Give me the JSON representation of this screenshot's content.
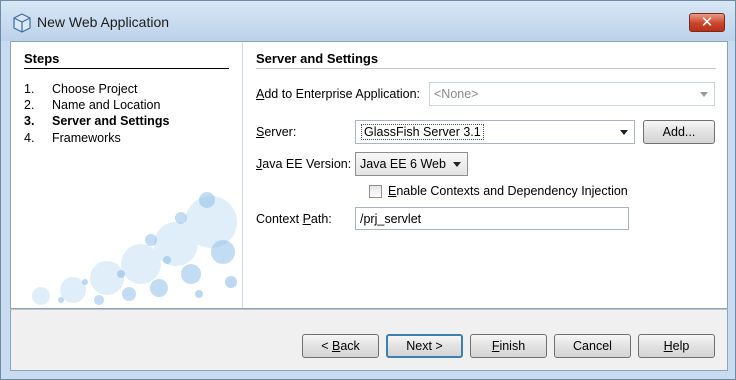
{
  "window": {
    "title": "New Web Application"
  },
  "steps": {
    "heading": "Steps",
    "items": [
      {
        "num": "1.",
        "label": "Choose Project"
      },
      {
        "num": "2.",
        "label": "Name and Location"
      },
      {
        "num": "3.",
        "label": "Server and Settings",
        "current": true
      },
      {
        "num": "4.",
        "label": "Frameworks"
      }
    ]
  },
  "panel": {
    "heading": "Server and Settings",
    "enterprise": {
      "label_mnemonic": "A",
      "label_rest": "dd to Enterprise Application:",
      "value": "<None>",
      "disabled": true
    },
    "server": {
      "label_mnemonic": "S",
      "label_rest": "erver:",
      "value": "GlassFish Server 3.1",
      "add_button_label": "Add..."
    },
    "javaee": {
      "label_mnemonic": "J",
      "label_rest": "ava EE Version:",
      "value": "Java EE 6 Web"
    },
    "cdi": {
      "label": "Enable Contexts and Dependency Injection",
      "label_mnemonic": "E",
      "label_rest": "nable Contexts and Dependency Injection",
      "checked": false
    },
    "context_path": {
      "label_pre": "Context ",
      "label_mnemonic": "P",
      "label_post": "ath:",
      "value": "/prj_servlet"
    }
  },
  "buttons": {
    "back": {
      "pre": "< ",
      "mnemonic": "B",
      "post": "ack"
    },
    "next": {
      "label": "Next >"
    },
    "finish": {
      "mnemonic": "F",
      "post": "inish"
    },
    "cancel": {
      "label": "Cancel"
    },
    "help": {
      "mnemonic": "H",
      "post": "elp"
    }
  }
}
